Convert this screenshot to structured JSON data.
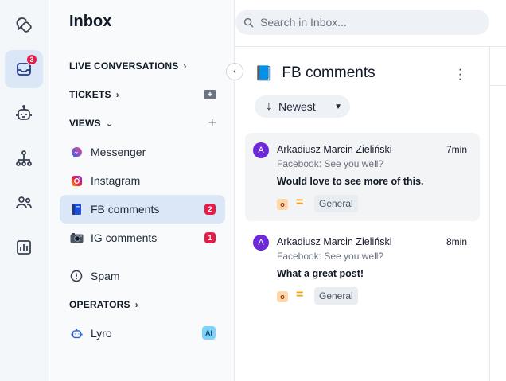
{
  "rail": {
    "inbox_badge": "3"
  },
  "nav": {
    "title": "Inbox",
    "sections": {
      "live": "LIVE CONVERSATIONS",
      "tickets": "TICKETS",
      "views": "VIEWS",
      "operators": "OPERATORS"
    },
    "views": [
      {
        "label": "Messenger",
        "icon": "messenger-icon"
      },
      {
        "label": "Instagram",
        "icon": "instagram-icon"
      },
      {
        "label": "FB comments",
        "icon": "blue-book-icon",
        "count": "2"
      },
      {
        "label": "IG comments",
        "icon": "camera-icon",
        "count": "1"
      }
    ],
    "spam": "Spam",
    "operators": [
      {
        "label": "Lyro",
        "badge": "AI"
      }
    ]
  },
  "search": {
    "placeholder": "Search in Inbox..."
  },
  "list": {
    "title": "FB comments",
    "title_emoji": "📘",
    "sort_label": "Newest",
    "conversations": [
      {
        "avatar": "A",
        "name": "Arkadiusz Marcin Zieliński",
        "time": "7min",
        "source": "Facebook: See you well?",
        "message": "Would love to see more of this.",
        "priority": "o",
        "tag": "General"
      },
      {
        "avatar": "A",
        "name": "Arkadiusz Marcin Zieliński",
        "time": "8min",
        "source": "Facebook: See you well?",
        "message": "What a great post!",
        "priority": "o",
        "tag": "General"
      }
    ]
  },
  "colors": {
    "accent": "#6d28d9",
    "badge": "#e11d48",
    "active_bg": "#dbe6f7",
    "priority": "#fed7aa"
  }
}
